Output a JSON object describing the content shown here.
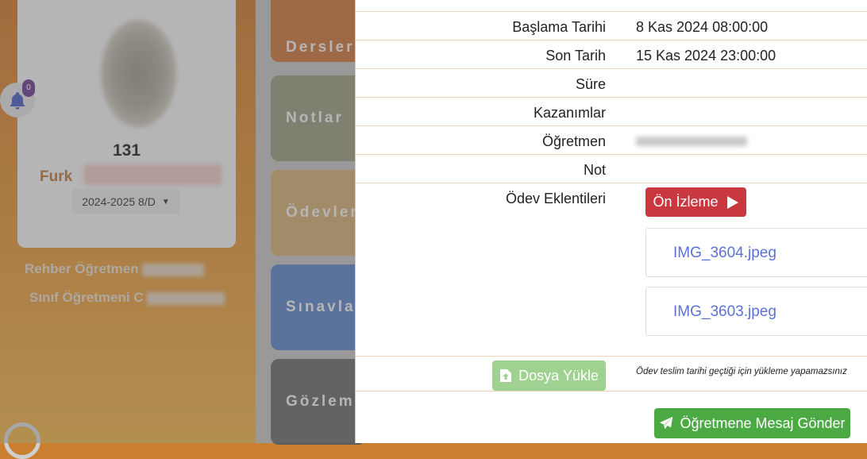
{
  "background": {
    "student_number": "131",
    "student_name_visible": "Furk",
    "class_select": "2024-2025 8/D",
    "guidance_teacher_label": "Rehber Öğretmen",
    "class_teacher_label": "Sınıf Öğretmeni",
    "class_teacher_initial": "C",
    "notification_count": "0",
    "menu": [
      "Dersler",
      "Notlar",
      "Ödevler",
      "Sınavlar",
      "Gözlem"
    ],
    "menu_colors": [
      "#c1662a",
      "#8e8e74",
      "#c7a064",
      "#4f76bd",
      "#5c5c5c"
    ]
  },
  "details": {
    "start_label": "Başlama Tarihi",
    "start_value": "8 Kas 2024 08:00:00",
    "end_label": "Son Tarih",
    "end_value": "15 Kas 2024 23:00:00",
    "duration_label": "Süre",
    "duration_value": "",
    "outcomes_label": "Kazanımlar",
    "outcomes_value": "",
    "teacher_label": "Öğretmen",
    "note_label": "Not",
    "note_value": "",
    "attachments_label": "Ödev Eklentileri"
  },
  "attachments": {
    "preview_button": "Ön İzleme",
    "files": [
      "IMG_3604.jpeg",
      "IMG_3603.jpeg"
    ]
  },
  "upload": {
    "button_label": "Dosya Yükle",
    "note": "Ödev teslim tarihi geçtiği için yükleme yapamazsınız"
  },
  "message_button": "Öğretmene Mesaj Gönder",
  "colors": {
    "preview_red": "#c9373f",
    "upload_green_disabled": "#9fd290",
    "message_green": "#4caa45",
    "link_blue": "#5a72d6",
    "row_border": "#f0d6b8"
  }
}
